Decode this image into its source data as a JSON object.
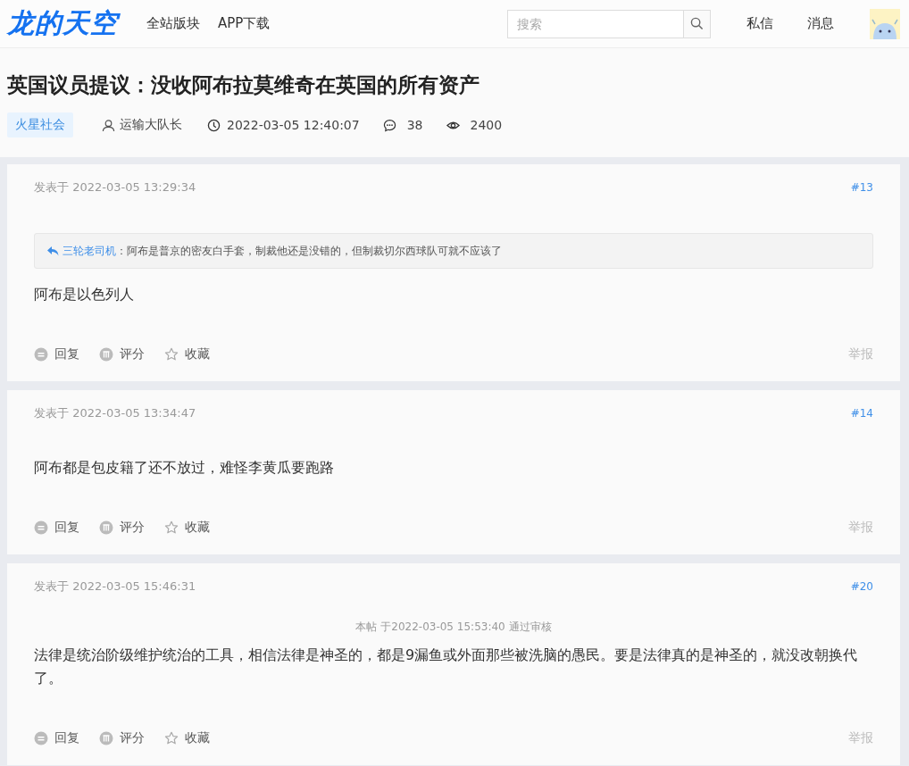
{
  "header": {
    "logo": "龙的天空",
    "nav": [
      "全站版块",
      "APP下载"
    ],
    "search": {
      "placeholder": "搜索"
    },
    "links": [
      "私信",
      "消息"
    ]
  },
  "thread": {
    "title": "英国议员提议：没收阿布拉莫维奇在英国的所有资产",
    "board": "火星社会",
    "author": "运输大队长",
    "time": "2022-03-05 12:40:07",
    "replies": "38",
    "views": "2400"
  },
  "posts": [
    {
      "time": "发表于 2022-03-05 13:29:34",
      "floor": "#13",
      "quote": {
        "user": "三轮老司机",
        "text": "：阿布是普京的密友白手套，制裁他还是没错的，但制裁切尔西球队可就不应该了"
      },
      "body": "阿布是以色列人",
      "actions": [
        {
          "kind": "reply",
          "label": "回复"
        },
        {
          "kind": "rate",
          "label": "评分"
        },
        {
          "kind": "favorite",
          "label": "收藏"
        }
      ],
      "report": "举报"
    },
    {
      "time": "发表于 2022-03-05 13:34:47",
      "floor": "#14",
      "body": "阿布都是包皮籍了还不放过，难怪李黄瓜要跑路",
      "actions": [
        {
          "kind": "reply",
          "label": "回复"
        },
        {
          "kind": "rate",
          "label": "评分"
        },
        {
          "kind": "favorite",
          "label": "收藏"
        }
      ],
      "report": "举报"
    },
    {
      "time": "发表于 2022-03-05 15:46:31",
      "floor": "#20",
      "notice": "本帖 于2022-03-05 15:53:40 通过审核",
      "body": "法律是统治阶级维护统治的工具，相信法律是神圣的，都是9漏鱼或外面那些被洗脑的愚民。要是法律真的是神圣的，就没改朝换代了。",
      "actions": [
        {
          "kind": "reply",
          "label": "回复"
        },
        {
          "kind": "rate",
          "label": "评分"
        },
        {
          "kind": "favorite",
          "label": "收藏"
        }
      ],
      "report": "举报"
    }
  ]
}
